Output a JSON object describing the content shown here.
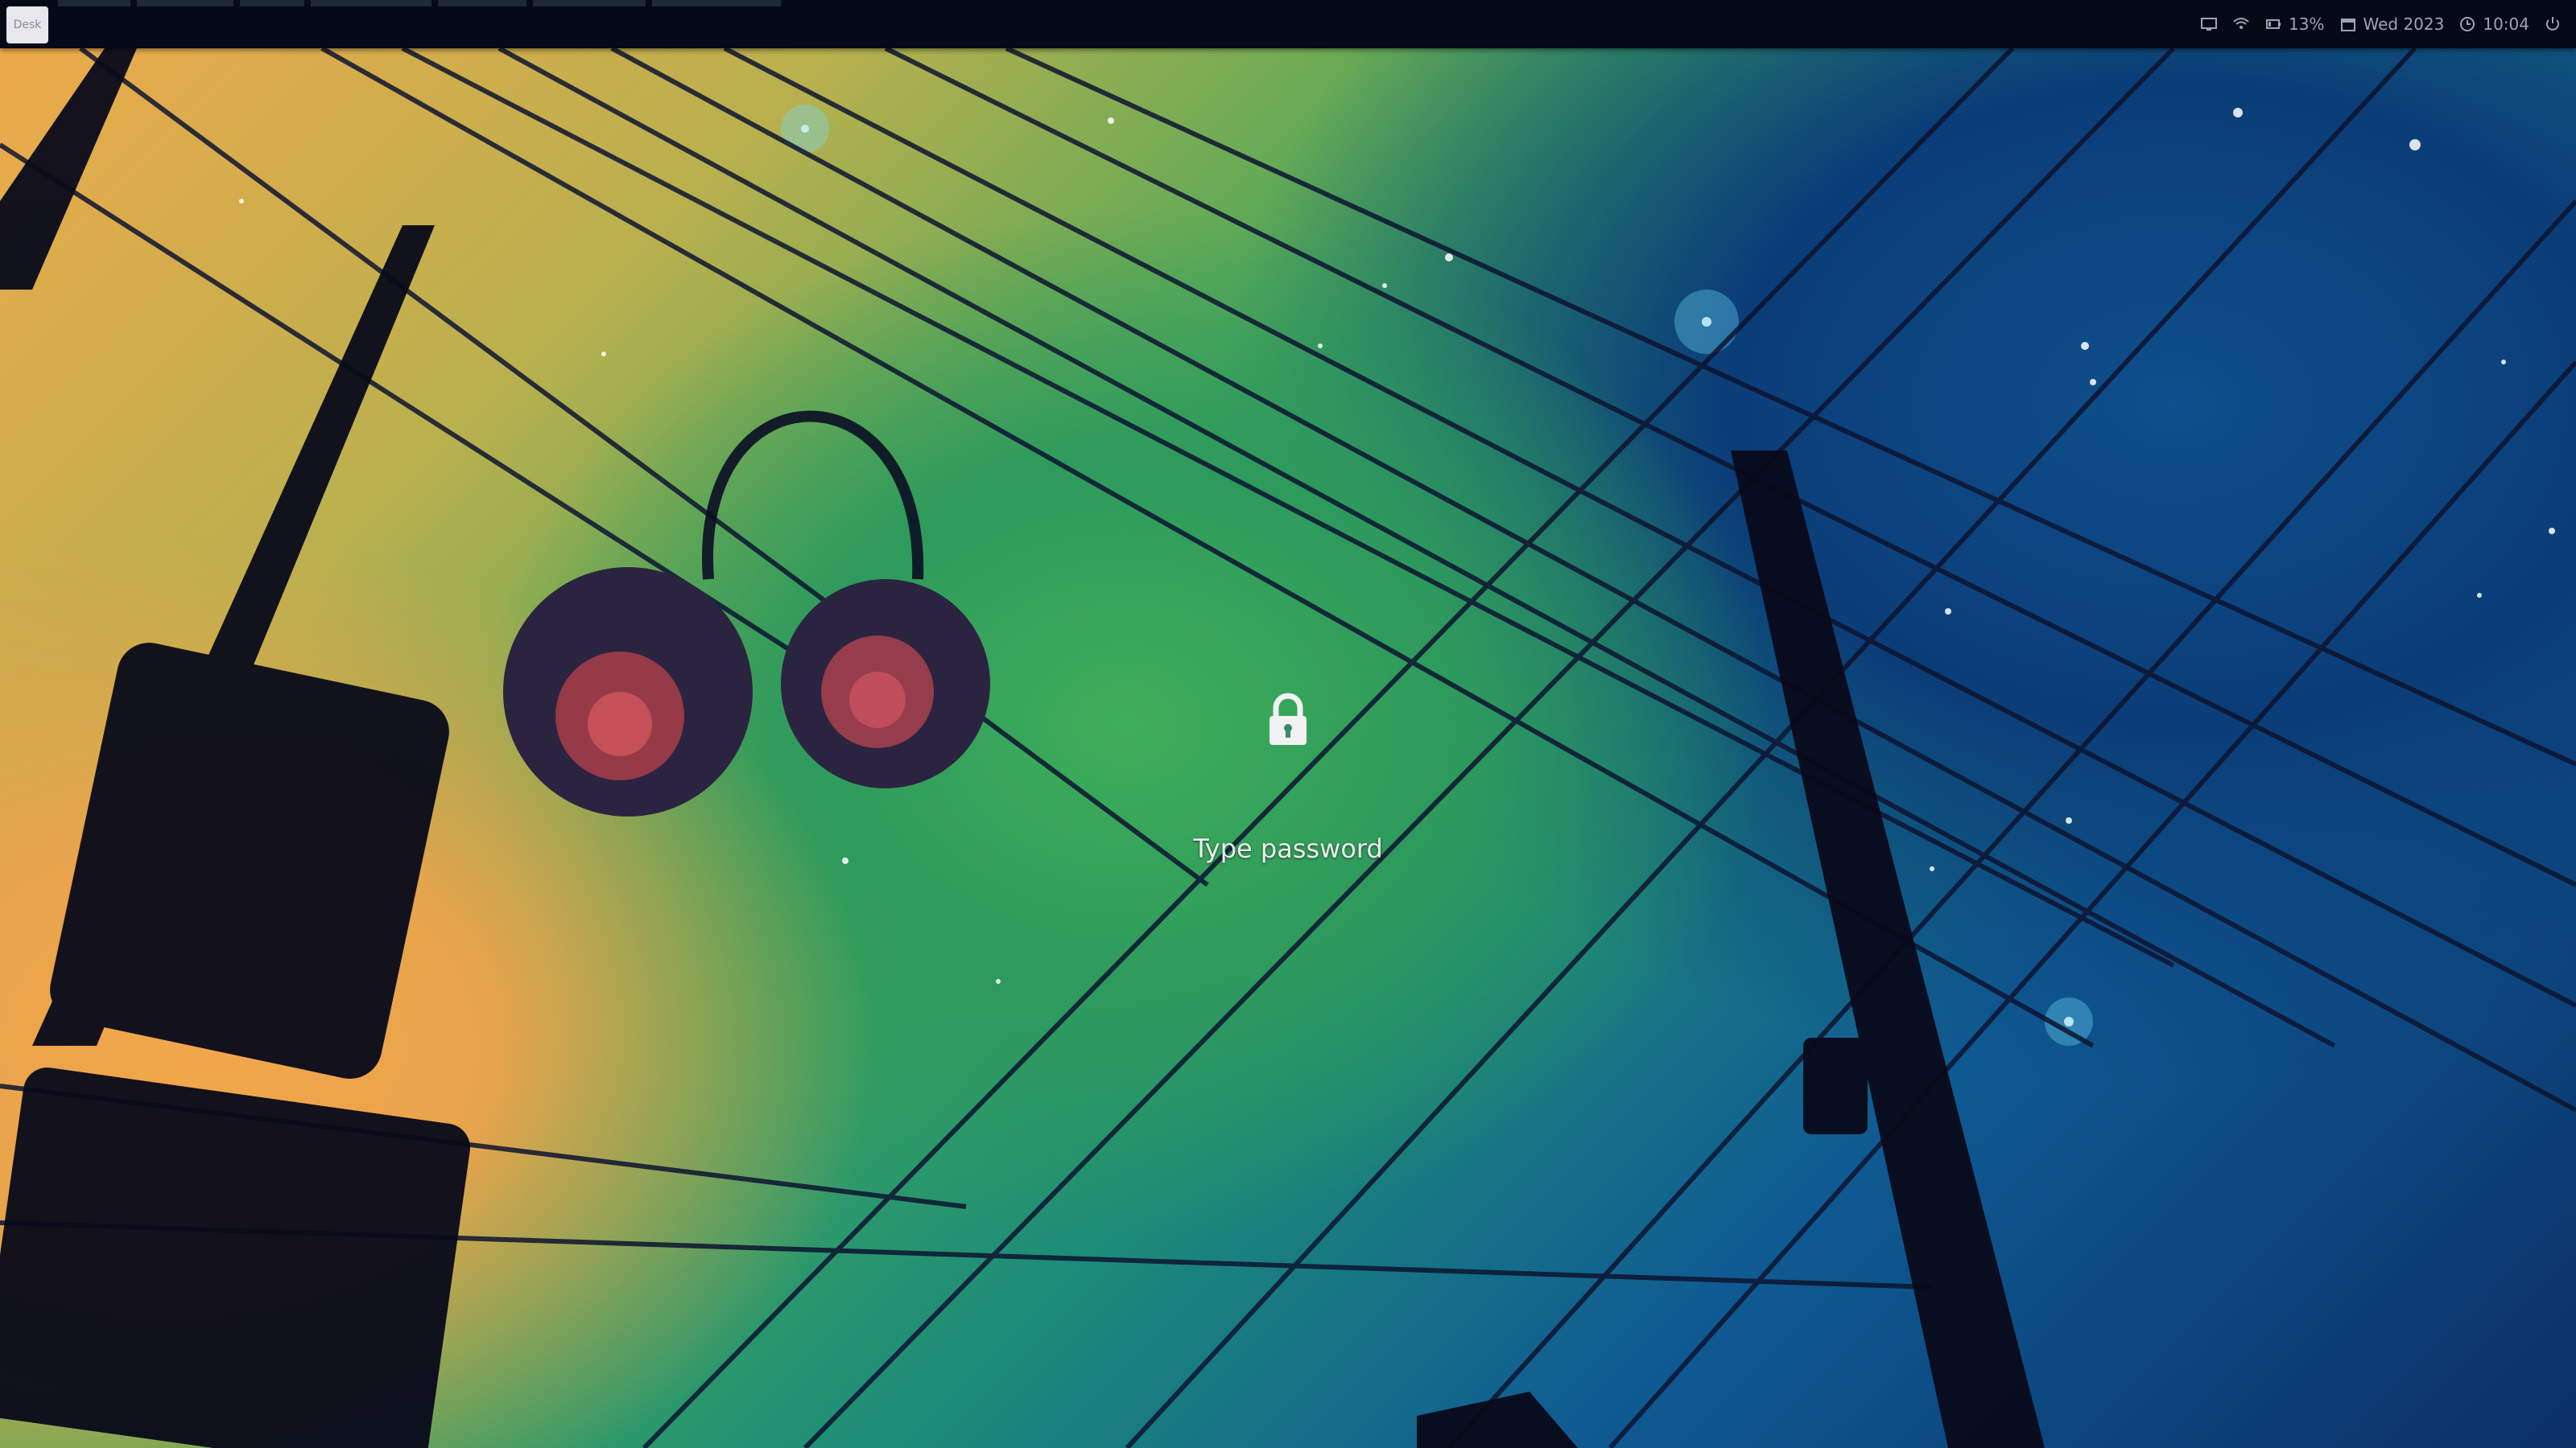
{
  "panel": {
    "workspace_label": "Desk",
    "tray": {
      "battery_text": "13%",
      "date_text": "Wed 2023",
      "time_text": "10:04",
      "icons": [
        "display-icon",
        "wifi-icon",
        "battery-icon",
        "calendar-icon",
        "clock-icon",
        "power-icon"
      ]
    }
  },
  "lock_screen": {
    "lock_icon": "lock-icon",
    "prompt": "Type password"
  }
}
